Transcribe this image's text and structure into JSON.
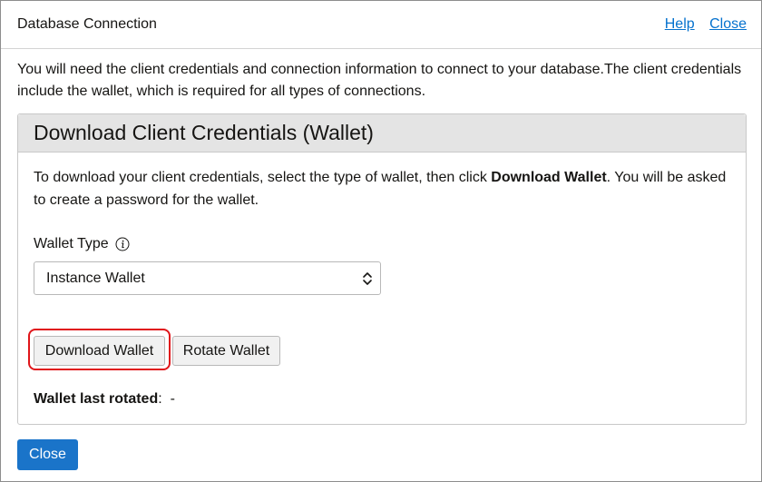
{
  "dialog": {
    "title": "Database Connection",
    "help_link": "Help",
    "close_link": "Close",
    "intro_text": "You will need the client credentials and connection information to connect to your database.The client credentials include the wallet, which is required for all types of connections."
  },
  "panel": {
    "title": "Download Client Credentials (Wallet)",
    "desc_before": "To download your client credentials, select the type of wallet, then click ",
    "desc_bold": "Download Wallet",
    "desc_after": ". You will be asked to create a password for the wallet.",
    "wallet_type_label": "Wallet Type",
    "wallet_type_value": "Instance Wallet",
    "download_button": "Download Wallet",
    "rotate_button": "Rotate Wallet",
    "last_rotated_label": "Wallet last rotated",
    "last_rotated_sep": ":  ",
    "last_rotated_value": "-"
  },
  "footer": {
    "close_button": "Close"
  },
  "colors": {
    "link": "#0572ce",
    "primary_button": "#1a74c9",
    "highlight": "#e0151a",
    "panel_header": "#e4e4e4"
  },
  "icons": {
    "info": "info-icon",
    "select_arrows": "chevron-up-down-icon"
  }
}
